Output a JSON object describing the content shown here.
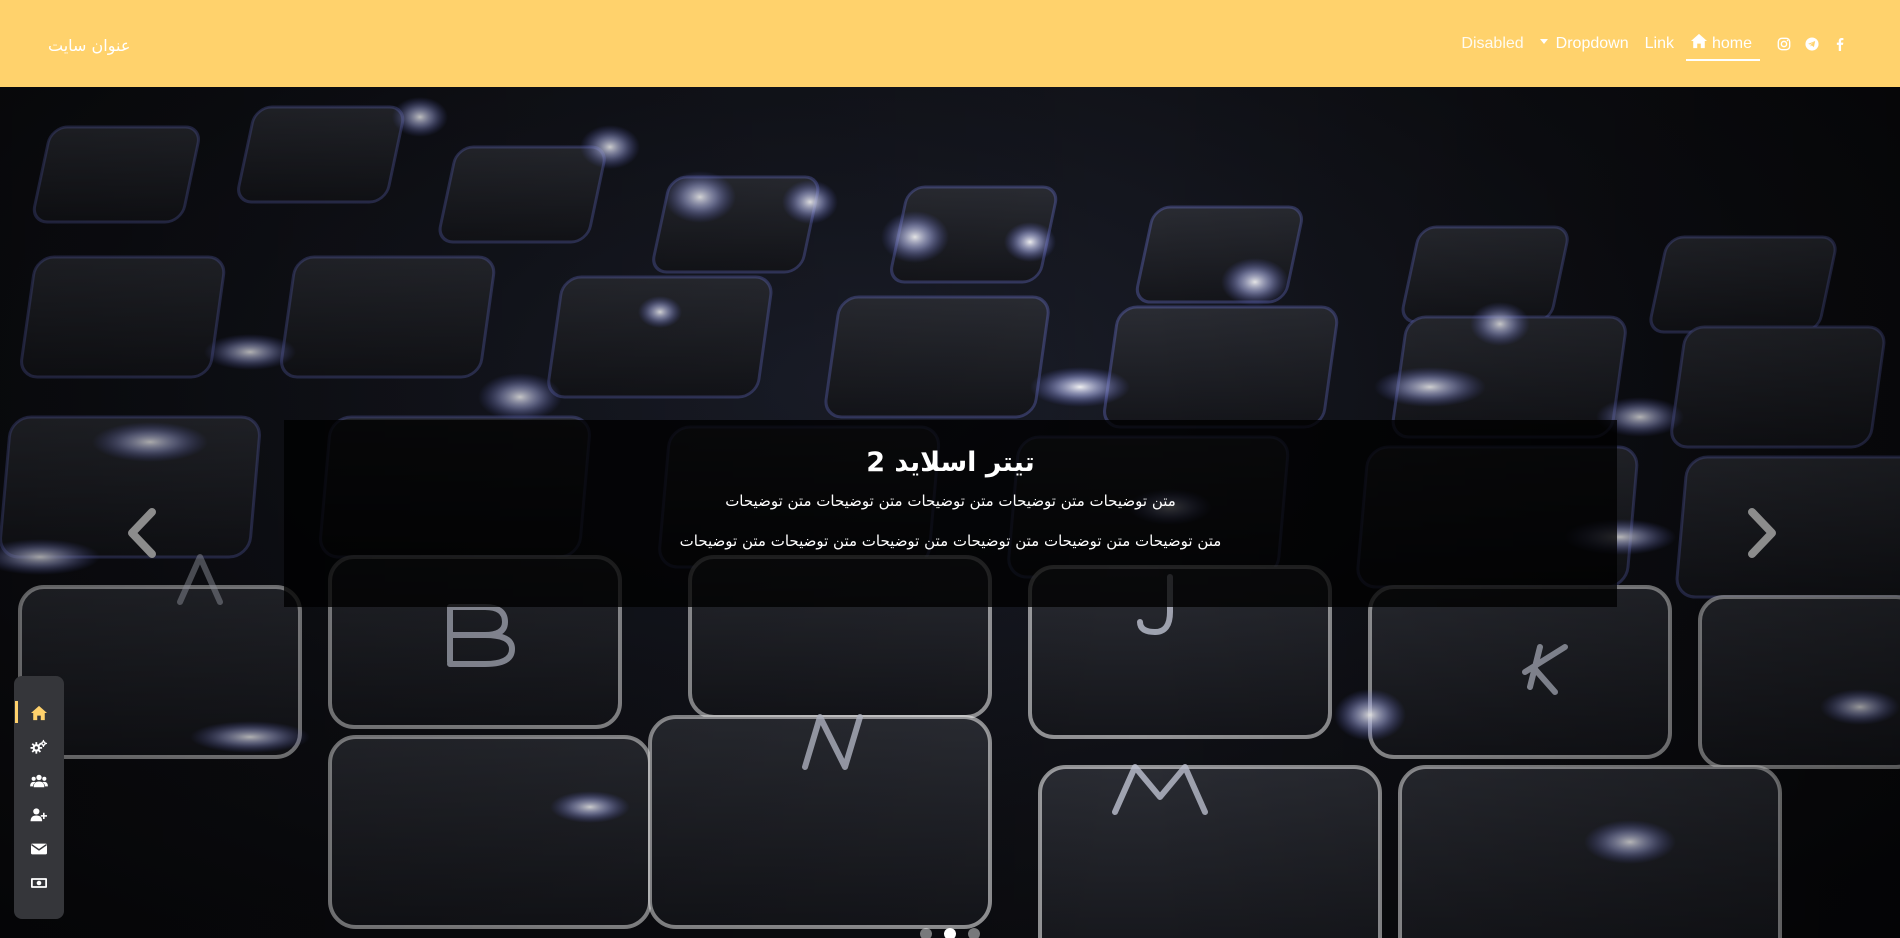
{
  "header": {
    "brand": "عنوان سایت",
    "nav": {
      "disabled": "Disabled",
      "dropdown": "Dropdown",
      "link": "Link",
      "home": "home"
    },
    "social_icons": [
      "instagram-icon",
      "telegram-icon",
      "facebook-icon"
    ]
  },
  "slider": {
    "title": "تیتر اسلاید 2",
    "line1": "متن توضیحات متن توضیحات متن توضیحات متن توضیحات متن توضیحات",
    "line2": "متن توضیحات متن توضیحات متن توضیحات متن توضیحات متن توضیحات متن توضیحات",
    "active_index": 2,
    "slide_count": 3
  },
  "dock": {
    "items": [
      "home-icon",
      "settings-icon",
      "users-icon",
      "add-user-icon",
      "mail-icon",
      "money-icon"
    ],
    "active": "home-icon"
  },
  "colors": {
    "accent": "#ffd26c",
    "dock_bg": "#35363a",
    "caption_bg": "#000000"
  }
}
